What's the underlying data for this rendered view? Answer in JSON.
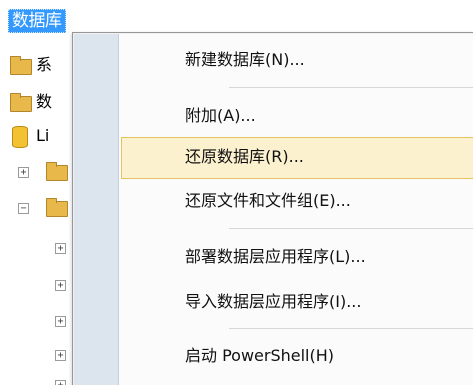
{
  "explorer": {
    "header": "数据库",
    "nodes": [
      {
        "icon": "folder-icon",
        "label": "系"
      },
      {
        "icon": "folder-icon",
        "label": "数"
      },
      {
        "icon": "database-icon",
        "label": "Li"
      },
      {
        "icon": "folder-icon",
        "label": "",
        "expander": "+"
      },
      {
        "icon": "folder-icon",
        "label": "",
        "expander": "−"
      }
    ],
    "child_expanders": [
      "+",
      "+",
      "+",
      "+",
      "+"
    ]
  },
  "context_menu": {
    "items": [
      {
        "label": "新建数据库(N)..."
      },
      {
        "label": "附加(A)..."
      },
      {
        "label": "还原数据库(R)...",
        "highlighted": true
      },
      {
        "label": "还原文件和文件组(E)..."
      },
      {
        "label": "部署数据层应用程序(L)..."
      },
      {
        "label": "导入数据层应用程序(I)..."
      },
      {
        "label": "启动 PowerShell(H)"
      }
    ]
  },
  "colors": {
    "selection_blue": "#3399ff",
    "menu_highlight": "#fcf1cf",
    "menu_highlight_border": "#e5c365",
    "menu_gutter": "#dce4ee"
  }
}
